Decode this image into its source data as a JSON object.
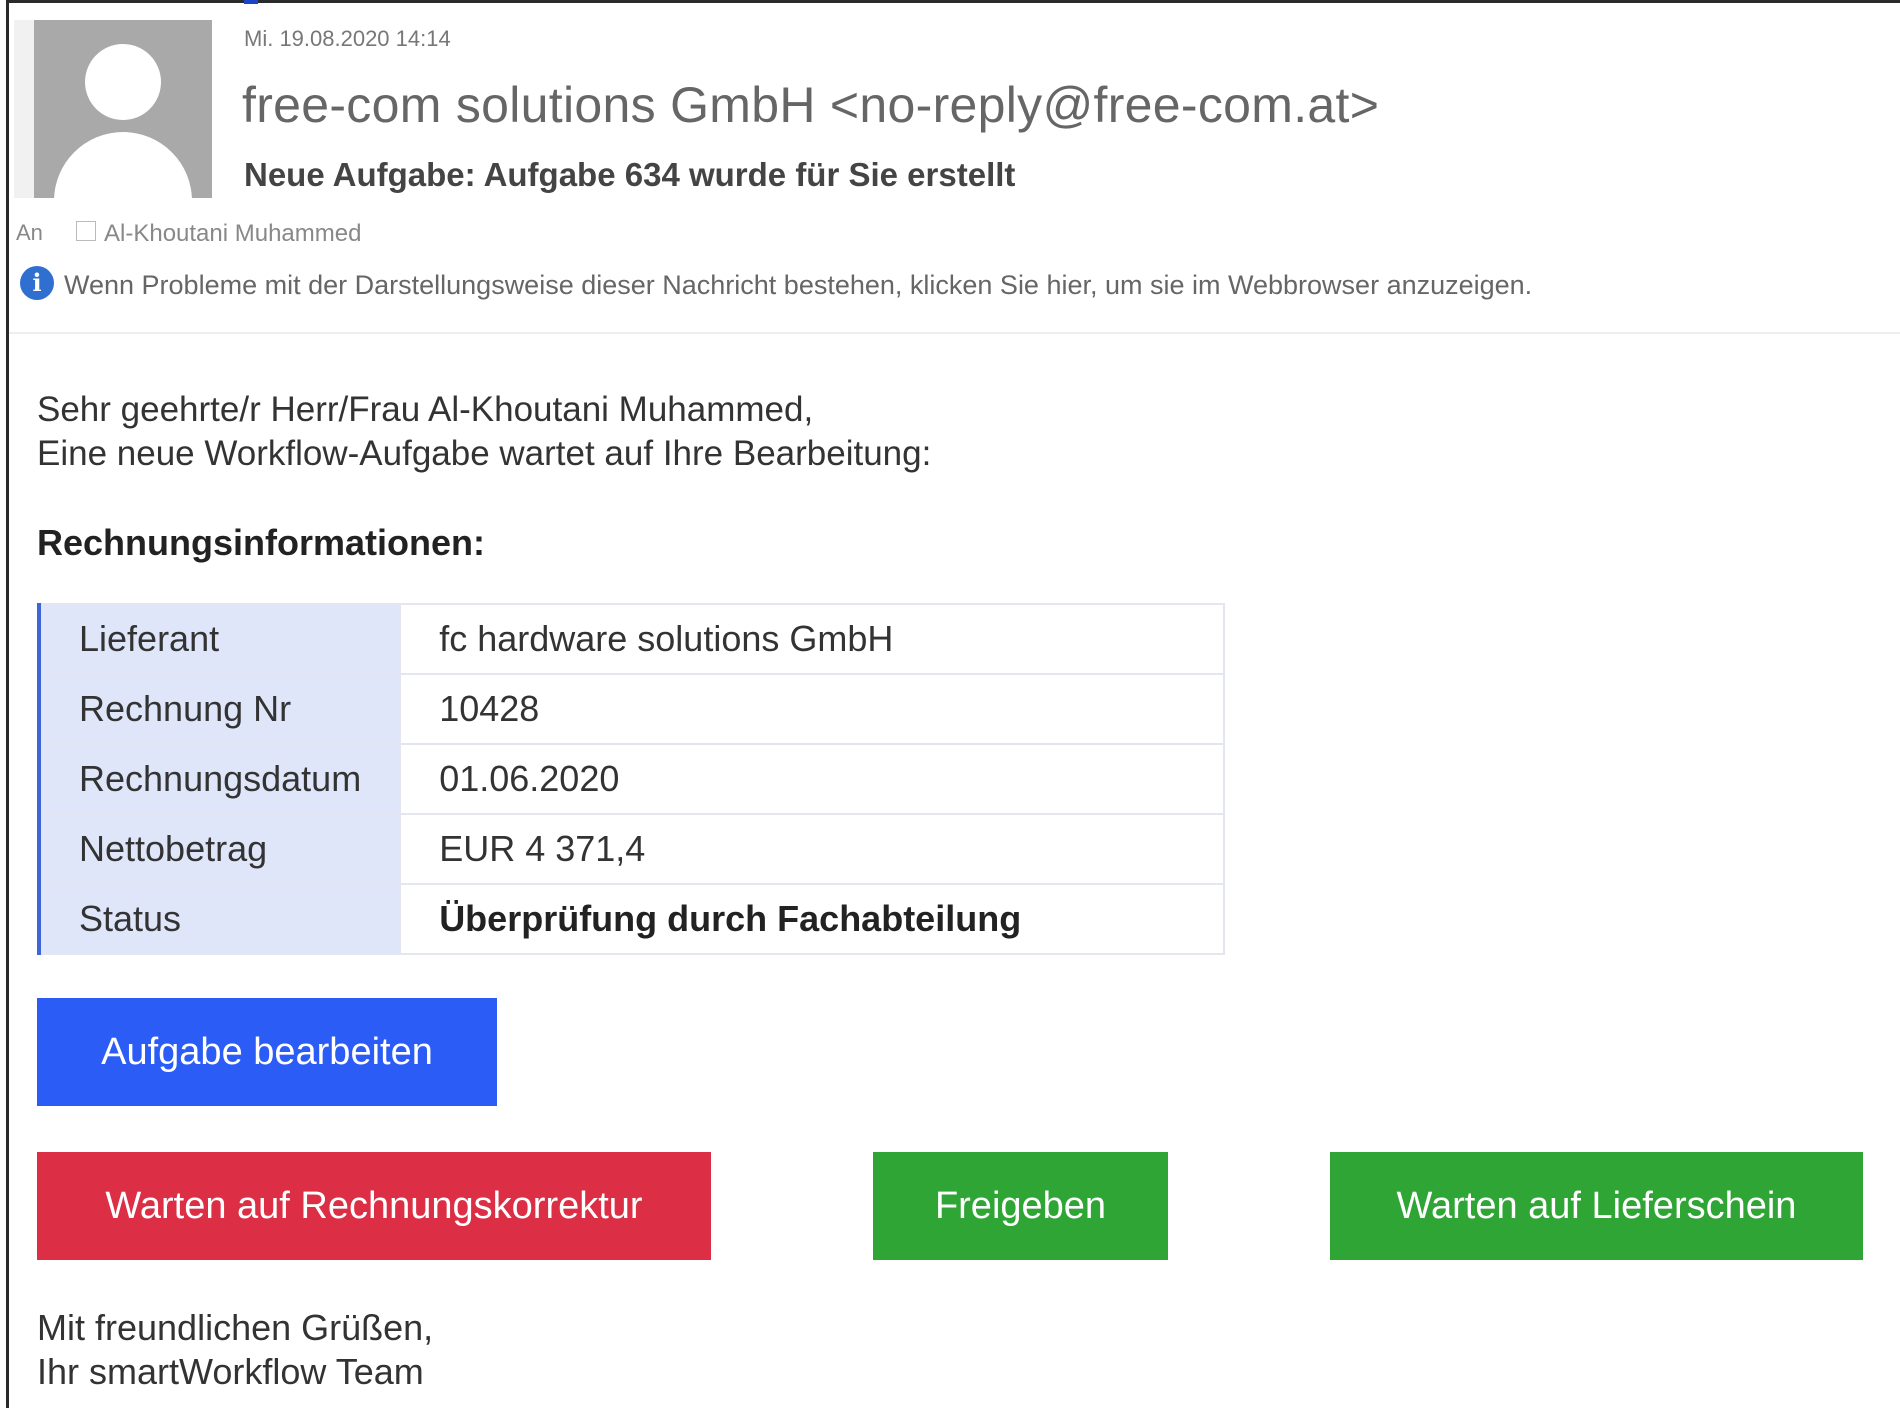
{
  "header": {
    "date": "Mi. 19.08.2020 14:14",
    "sender": "free-com solutions GmbH <no-reply@free-com.at>",
    "subject": "Neue Aufgabe: Aufgabe 634 wurde für Sie erstellt",
    "to_label": "An",
    "recipient": "Al-Khoutani Muhammed",
    "info_notice": "Wenn Probleme mit der Darstellungsweise dieser Nachricht bestehen, klicken Sie hier, um sie im Webbrowser anzuzeigen.",
    "info_icon": "i"
  },
  "body": {
    "greeting_line1": "Sehr geehrte/r Herr/Frau Al-Khoutani Muhammed,",
    "greeting_line2": "Eine neue Workflow-Aufgabe wartet auf Ihre Bearbeitung:",
    "section_title": "Rechnungsinformationen:",
    "invoice_rows": [
      {
        "key": "Lieferant",
        "value": "fc hardware solutions GmbH"
      },
      {
        "key": "Rechnung Nr",
        "value": "10428"
      },
      {
        "key": "Rechnungsdatum",
        "value": "01.06.2020"
      },
      {
        "key": "Nettobetrag",
        "value": "EUR 4 371,4"
      },
      {
        "key": "Status",
        "value": "Überprüfung durch Fachabteilung"
      }
    ],
    "buttons": {
      "edit": "Aufgabe bearbeiten",
      "correction": "Warten auf Rechnungskorrektur",
      "release": "Freigeben",
      "delivery_note": "Warten auf Lieferschein"
    },
    "closing_line1": "Mit freundlichen Grüßen,",
    "closing_line2": "Ihr smartWorkflow Team"
  },
  "colors": {
    "edit_button": "#2b5cf6",
    "correction_button": "#dc2f45",
    "release_button": "#2ea535",
    "delivery_button": "#2ea535",
    "table_key_bg": "#e0e6fa",
    "table_accent": "#3f66d6"
  },
  "icons": {
    "avatar": "person-silhouette-icon",
    "info": "info-icon"
  }
}
